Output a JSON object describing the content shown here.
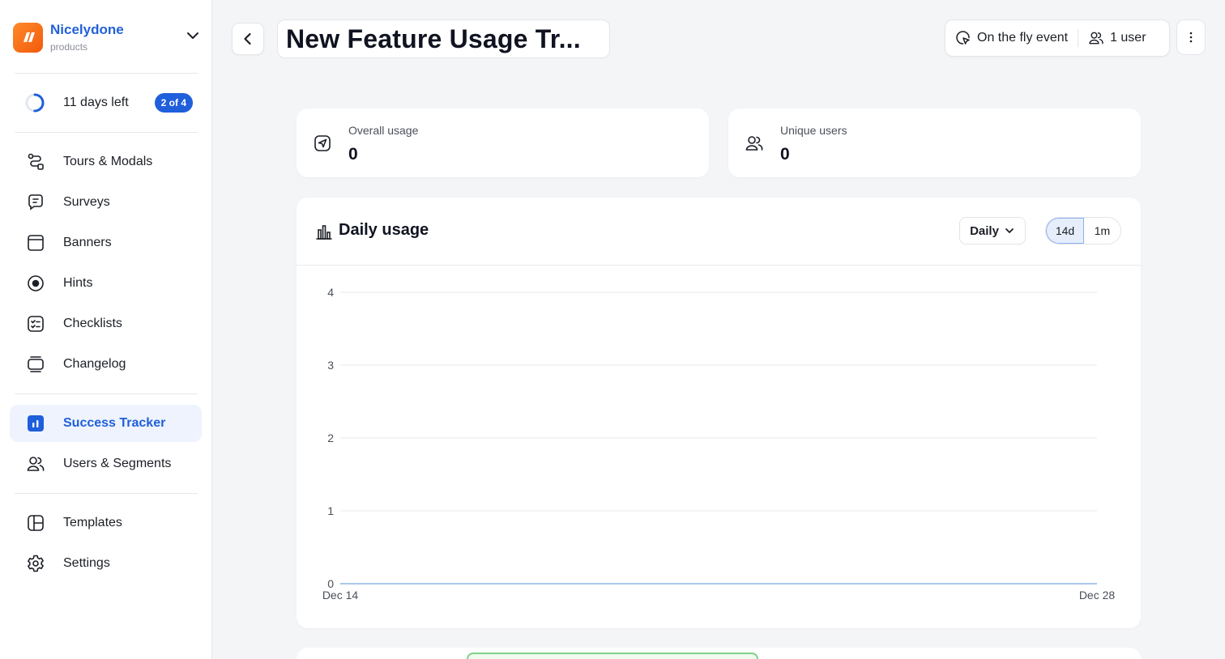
{
  "brand": {
    "name": "Nicelydone",
    "subtitle": "products"
  },
  "trial": {
    "text": "11 days left",
    "badge": "2 of 4",
    "progress": 0.5
  },
  "nav": {
    "tours": "Tours & Modals",
    "surveys": "Surveys",
    "banners": "Banners",
    "hints": "Hints",
    "checklists": "Checklists",
    "changelog": "Changelog",
    "success": "Success Tracker",
    "users": "Users & Segments",
    "templates": "Templates",
    "settings": "Settings"
  },
  "header": {
    "title": "New Feature Usage Tr...",
    "event": "On the fly event",
    "users": "1 user"
  },
  "stats": {
    "overall_label": "Overall usage",
    "overall_value": "0",
    "unique_label": "Unique users",
    "unique_value": "0"
  },
  "chart_card": {
    "title": "Daily usage",
    "granularity": "Daily",
    "range_14d": "14d",
    "range_1m": "1m",
    "active_range": "14d"
  },
  "colors": {
    "accent": "#1f5fdb",
    "line": "#a9c7ea",
    "grid": "#e6e8ec"
  },
  "chart_data": {
    "type": "line",
    "title": "Daily usage",
    "x_start": "Dec 14",
    "x_end": "Dec 28",
    "x_tick_labels": [
      "Dec 14",
      "Dec 28"
    ],
    "y_ticks": [
      0,
      1,
      2,
      3,
      4
    ],
    "ylim": [
      0,
      4
    ],
    "grid": true,
    "series": [
      {
        "values": [
          0,
          0,
          0,
          0,
          0,
          0,
          0,
          0,
          0,
          0,
          0,
          0,
          0,
          0,
          0
        ]
      }
    ]
  }
}
